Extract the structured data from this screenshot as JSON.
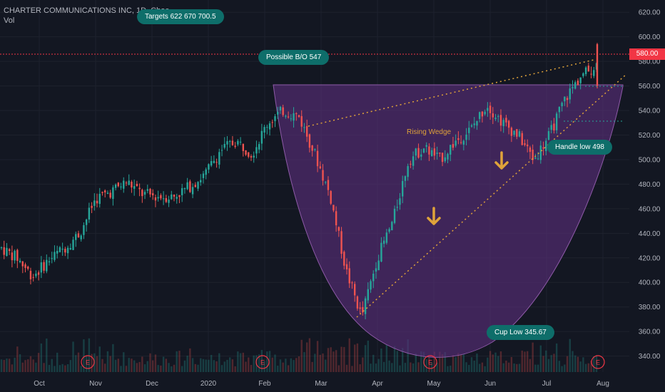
{
  "header": {
    "title": "CHARTER COMMUNICATIONS INC, 1D, Cboe",
    "volume_label": "Vol"
  },
  "annotations": {
    "targets": "Targets   622  670  700.5",
    "breakout": "Possible B/O    547",
    "wedge": "Rising Wedge",
    "handle_low": "Handle low    498",
    "cup_low": "Cup Low    345.67",
    "earnings_marker": "E"
  },
  "colors": {
    "background": "#131722",
    "up": "#26a69a",
    "down": "#ef5350",
    "cup_fill": "#5a2f7a",
    "callout": "#0e6e6a",
    "wedge_line": "#e0a33a",
    "price_line": "#f23645",
    "arrow": "#e0a33a"
  },
  "chart_data": {
    "type": "candlestick",
    "title": "CHARTER COMMUNICATIONS INC, 1D, Cboe",
    "ylabel": "",
    "ylim": [
      327,
      630
    ],
    "yticks": [
      340,
      360,
      380,
      400,
      420,
      440,
      460,
      480,
      500,
      520,
      540,
      560,
      580,
      600,
      620
    ],
    "xlabels": [
      "Oct",
      "Nov",
      "Dec",
      "2020",
      "Feb",
      "Mar",
      "Apr",
      "May",
      "Jun",
      "Jul",
      "Aug"
    ],
    "last_price": 580.0,
    "price_path": [
      [
        "Sep",
        428
      ],
      [
        "Sep-mid",
        420
      ],
      [
        "Oct-start",
        405
      ],
      [
        "Oct",
        418
      ],
      [
        "Oct-late",
        428
      ],
      [
        "Nov-start",
        440
      ],
      [
        "Nov",
        468
      ],
      [
        "Nov-mid",
        474
      ],
      [
        "Nov-late",
        482
      ],
      [
        "Dec-start",
        472
      ],
      [
        "Dec",
        470
      ],
      [
        "Dec-mid",
        470
      ],
      [
        "Dec-late",
        478
      ],
      [
        "2020",
        488
      ],
      [
        "Jan",
        508
      ],
      [
        "Jan-mid",
        515
      ],
      [
        "Jan-late",
        505
      ],
      [
        "Feb",
        530
      ],
      [
        "Feb-mid",
        540
      ],
      [
        "Feb-late",
        535
      ],
      [
        "Mar-start",
        505
      ],
      [
        "Mar",
        470
      ],
      [
        "Mar-mid",
        410
      ],
      [
        "Mar-low",
        372
      ],
      [
        "Apr-start",
        420
      ],
      [
        "Apr",
        450
      ],
      [
        "Apr-mid",
        500
      ],
      [
        "Apr-late",
        510
      ],
      [
        "May",
        500
      ],
      [
        "May-mid",
        515
      ],
      [
        "May-late",
        525
      ],
      [
        "Jun",
        545
      ],
      [
        "Jun-mid",
        530
      ],
      [
        "Jun-late",
        520
      ],
      [
        "Jul",
        500
      ],
      [
        "Jul-mid",
        520
      ],
      [
        "Jul-late",
        550
      ],
      [
        "Aug",
        568
      ],
      [
        "Aug-peak",
        577
      ]
    ],
    "earnings_markers": [
      "Oct-late",
      "Jan-late",
      "Apr-late",
      "Jul-late"
    ],
    "levels": {
      "breakout": 547,
      "handle_low": 498,
      "cup_low": 345.67,
      "targets": [
        622,
        670,
        700.5
      ]
    }
  }
}
